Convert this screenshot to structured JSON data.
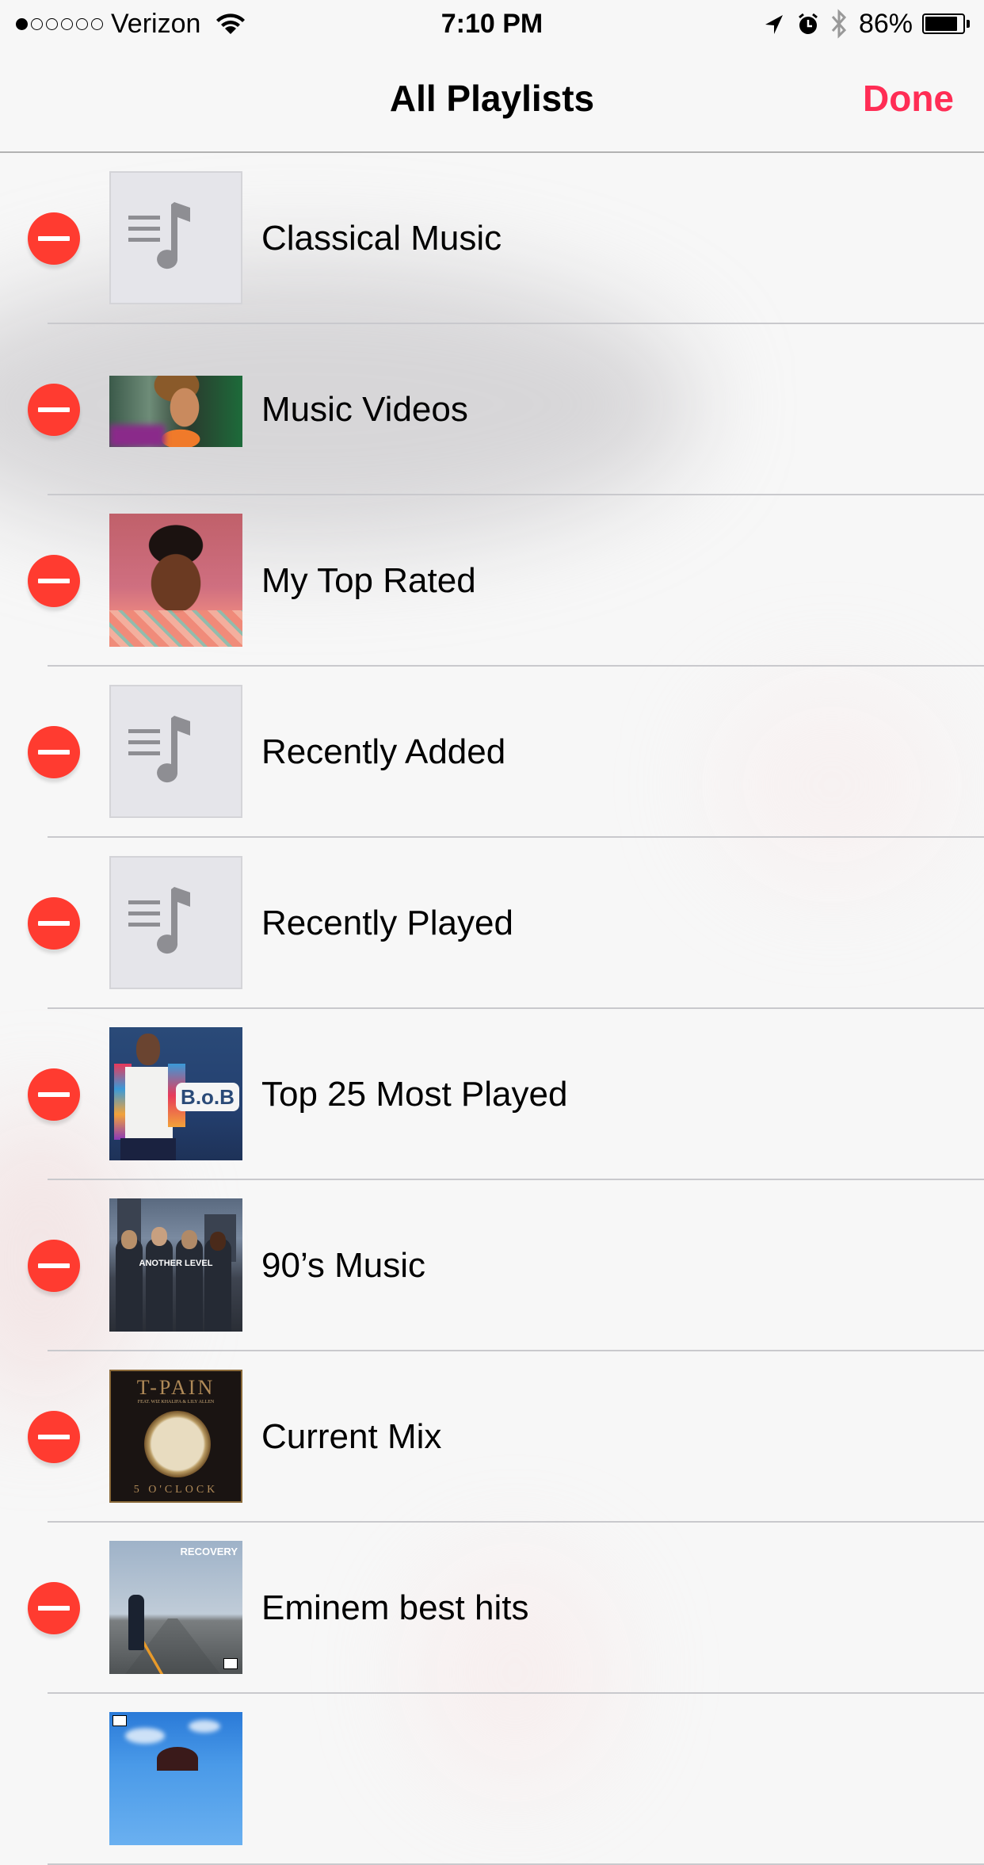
{
  "status_bar": {
    "signal_strength": {
      "filled": 1,
      "total": 6
    },
    "carrier": "Verizon",
    "wifi_icon": "wifi-icon",
    "time": "7:10 PM",
    "icons": [
      "location-arrow-icon",
      "alarm-clock-icon",
      "bluetooth-icon"
    ],
    "battery_percent_label": "86%",
    "battery_level": 0.86
  },
  "nav": {
    "title": "All Playlists",
    "done_label": "Done",
    "accent_color": "#ff2d55"
  },
  "playlists": [
    {
      "title": "Classical Music",
      "artwork": "placeholder-playlist-icon"
    },
    {
      "title": "Music Videos",
      "artwork": "music-video-thumbnail"
    },
    {
      "title": "My Top Rated",
      "artwork": "album-artwork"
    },
    {
      "title": "Recently Added",
      "artwork": "placeholder-playlist-icon"
    },
    {
      "title": "Recently Played",
      "artwork": "placeholder-playlist-icon"
    },
    {
      "title": "Top 25 Most Played",
      "artwork": "album-artwork",
      "artwork_text": "B.o.B"
    },
    {
      "title": "90’s Music",
      "artwork": "album-artwork",
      "artwork_text": "ANOTHER LEVEL"
    },
    {
      "title": "Current Mix",
      "artwork": "album-artwork",
      "artwork_text": [
        "T-PAIN",
        "FEAT. WIZ KHALIFA & LILY ALLEN",
        "5 O'CLOCK"
      ]
    },
    {
      "title": "Eminem best hits",
      "artwork": "album-artwork",
      "artwork_text": "RECOVERY"
    },
    {
      "title": "",
      "artwork": "album-artwork",
      "partially_visible": true
    }
  ],
  "colors": {
    "delete_red": "#ff3b30",
    "separator": "#c9c9cd",
    "placeholder_bg": "#e5e5ea",
    "placeholder_glyph": "#8e8e93"
  }
}
